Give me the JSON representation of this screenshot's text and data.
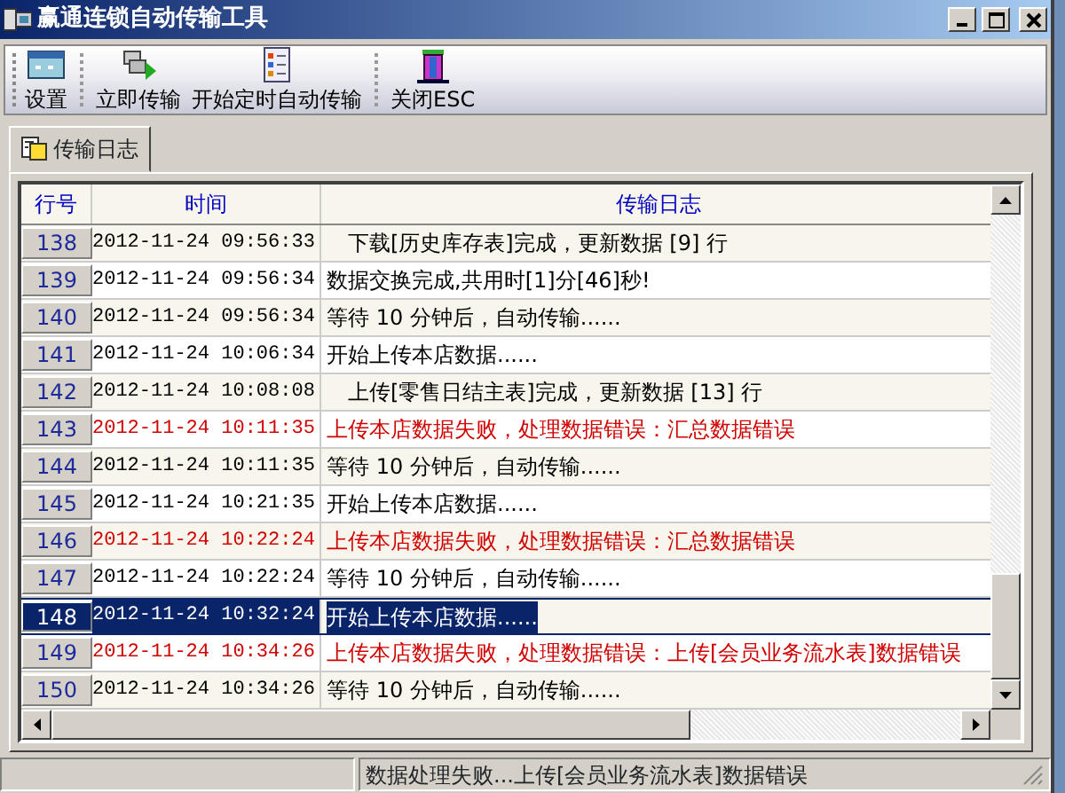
{
  "window": {
    "title": "赢通连锁自动传输工具"
  },
  "toolbar": [
    {
      "label": "设置",
      "kind": "settings"
    },
    {
      "label": "立即传输",
      "kind": "send"
    },
    {
      "label": "开始定时自动传输",
      "kind": "schedule"
    },
    {
      "label": "关闭ESC",
      "kind": "exit"
    }
  ],
  "tabs": [
    {
      "label": "传输日志",
      "selected": true
    }
  ],
  "table": {
    "columns": [
      "行号",
      "时间",
      "传输日志"
    ],
    "rows": [
      {
        "line": "138",
        "time": "2012-11-24 09:56:33",
        "log": "下载[历史库存表]完成，更新数据 [9] 行",
        "error": false,
        "indented": true,
        "selected": false
      },
      {
        "line": "139",
        "time": "2012-11-24 09:56:34",
        "log": "数据交换完成,共用时[1]分[46]秒!",
        "error": false,
        "indented": false,
        "selected": false
      },
      {
        "line": "140",
        "time": "2012-11-24 09:56:34",
        "log": "等待 10 分钟后，自动传输......",
        "error": false,
        "indented": false,
        "selected": false
      },
      {
        "line": "141",
        "time": "2012-11-24 10:06:34",
        "log": "开始上传本店数据......",
        "error": false,
        "indented": false,
        "selected": false
      },
      {
        "line": "142",
        "time": "2012-11-24 10:08:08",
        "log": "上传[零售日结主表]完成，更新数据 [13] 行",
        "error": false,
        "indented": true,
        "selected": false
      },
      {
        "line": "143",
        "time": "2012-11-24 10:11:35",
        "log": "上传本店数据失败，处理数据错误：汇总数据错误",
        "error": true,
        "indented": false,
        "selected": false
      },
      {
        "line": "144",
        "time": "2012-11-24 10:11:35",
        "log": "等待 10 分钟后，自动传输......",
        "error": false,
        "indented": false,
        "selected": false
      },
      {
        "line": "145",
        "time": "2012-11-24 10:21:35",
        "log": "开始上传本店数据......",
        "error": false,
        "indented": false,
        "selected": false
      },
      {
        "line": "146",
        "time": "2012-11-24 10:22:24",
        "log": "上传本店数据失败，处理数据错误：汇总数据错误",
        "error": true,
        "indented": false,
        "selected": false
      },
      {
        "line": "147",
        "time": "2012-11-24 10:22:24",
        "log": "等待 10 分钟后，自动传输......",
        "error": false,
        "indented": false,
        "selected": false
      },
      {
        "line": "148",
        "time": "2012-11-24 10:32:24",
        "log": "开始上传本店数据......",
        "error": false,
        "indented": false,
        "selected": true
      },
      {
        "line": "149",
        "time": "2012-11-24 10:34:26",
        "log": "上传本店数据失败，处理数据错误：上传[会员业务流水表]数据错误",
        "error": true,
        "indented": false,
        "selected": false
      },
      {
        "line": "150",
        "time": "2012-11-24 10:34:26",
        "log": "等待 10 分钟后，自动传输......",
        "error": false,
        "indented": false,
        "selected": false
      }
    ]
  },
  "status_bar": {
    "message": "数据处理失败...上传[会员业务流水表]数据错误"
  }
}
